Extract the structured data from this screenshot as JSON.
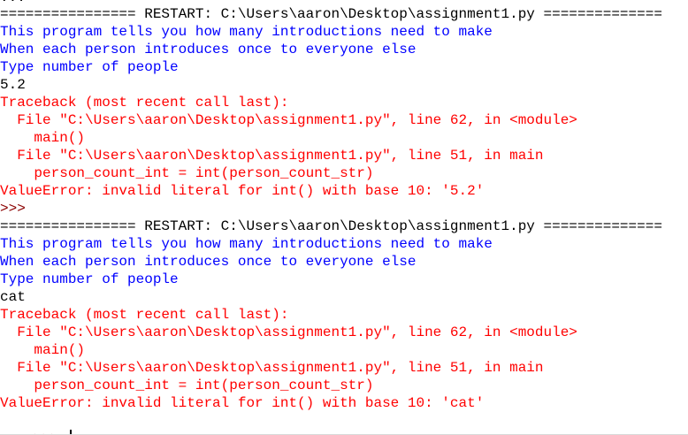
{
  "shell": {
    "top_fragment": "...",
    "lines": [
      {
        "text": "================ RESTART: C:\\Users\\aaron\\Desktop\\assignment1.py ==============",
        "color": "#000000",
        "kind": "restart-banner"
      },
      {
        "text": "This program tells you how many introductions need to make",
        "color": "#0000ff",
        "kind": "program-output"
      },
      {
        "text": "When each person introduces once to everyone else",
        "color": "#0000ff",
        "kind": "program-output"
      },
      {
        "text": "Type number of people",
        "color": "#0000ff",
        "kind": "program-output"
      },
      {
        "text": "5.2",
        "color": "#000000",
        "kind": "user-input"
      },
      {
        "text": "Traceback (most recent call last):",
        "color": "#ff0000",
        "kind": "traceback"
      },
      {
        "text": "  File \"C:\\Users\\aaron\\Desktop\\assignment1.py\", line 62, in <module>",
        "color": "#ff0000",
        "kind": "traceback"
      },
      {
        "text": "    main()",
        "color": "#ff0000",
        "kind": "traceback"
      },
      {
        "text": "  File \"C:\\Users\\aaron\\Desktop\\assignment1.py\", line 51, in main",
        "color": "#ff0000",
        "kind": "traceback"
      },
      {
        "text": "    person_count_int = int(person_count_str)",
        "color": "#ff0000",
        "kind": "traceback"
      },
      {
        "text": "ValueError: invalid literal for int() with base 10: '5.2'",
        "color": "#ff0000",
        "kind": "traceback"
      },
      {
        "text": ">>>",
        "color": "#8b0000",
        "kind": "prompt"
      },
      {
        "text": "================ RESTART: C:\\Users\\aaron\\Desktop\\assignment1.py ==============",
        "color": "#000000",
        "kind": "restart-banner"
      },
      {
        "text": "This program tells you how many introductions need to make",
        "color": "#0000ff",
        "kind": "program-output"
      },
      {
        "text": "When each person introduces once to everyone else",
        "color": "#0000ff",
        "kind": "program-output"
      },
      {
        "text": "Type number of people",
        "color": "#0000ff",
        "kind": "program-output"
      },
      {
        "text": "cat",
        "color": "#000000",
        "kind": "user-input"
      },
      {
        "text": "Traceback (most recent call last):",
        "color": "#ff0000",
        "kind": "traceback"
      },
      {
        "text": "  File \"C:\\Users\\aaron\\Desktop\\assignment1.py\", line 62, in <module>",
        "color": "#ff0000",
        "kind": "traceback"
      },
      {
        "text": "    main()",
        "color": "#ff0000",
        "kind": "traceback"
      },
      {
        "text": "  File \"C:\\Users\\aaron\\Desktop\\assignment1.py\", line 51, in main",
        "color": "#ff0000",
        "kind": "traceback"
      },
      {
        "text": "    person_count_int = int(person_count_str)",
        "color": "#ff0000",
        "kind": "traceback"
      },
      {
        "text": "ValueError: invalid literal for int() with base 10: 'cat'",
        "color": "#ff0000",
        "kind": "traceback"
      }
    ],
    "active_prompt": ">>> "
  }
}
